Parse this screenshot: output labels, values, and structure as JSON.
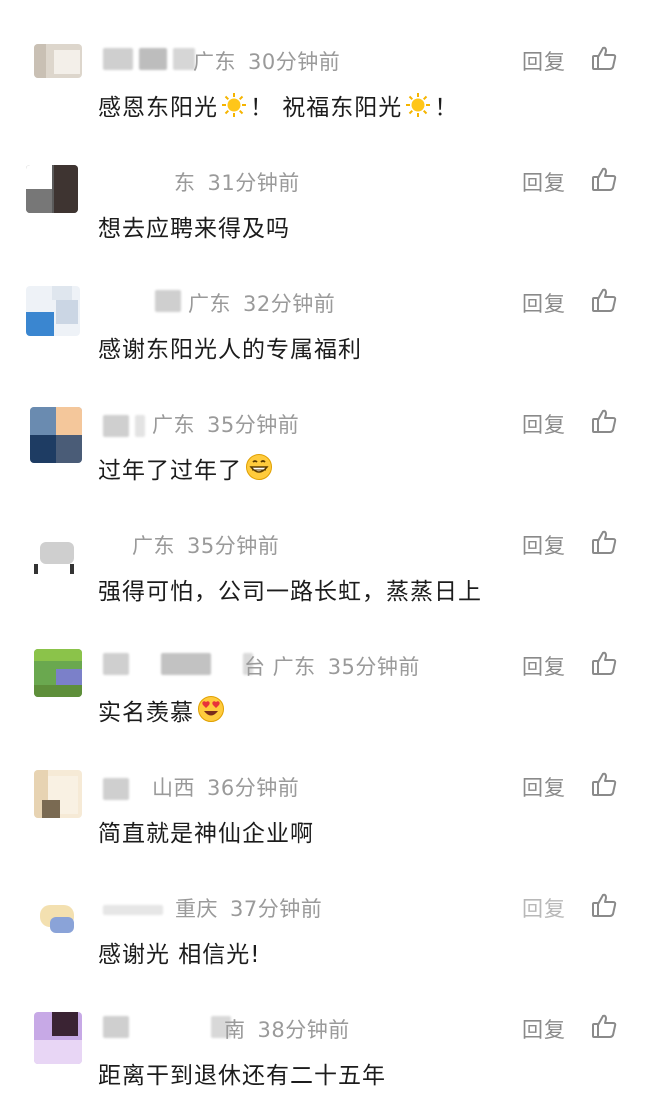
{
  "comments": [
    {
      "location": "广东",
      "time": "30分钟前",
      "text": "感恩东阳光",
      "text2": "！ 祝福东阳光",
      "text3": "！",
      "emoji": "sun",
      "reply": "回复"
    },
    {
      "location": "东",
      "time": "31分钟前",
      "text": "想去应聘来得及吗",
      "reply": "回复"
    },
    {
      "location": "广东",
      "time": "32分钟前",
      "text": "感谢东阳光人的专属福利",
      "reply": "回复"
    },
    {
      "location": "广东",
      "time": "35分钟前",
      "text": "过年了过年了",
      "emoji": "grin",
      "reply": "回复"
    },
    {
      "location": "广东",
      "time": "35分钟前",
      "text": "强得可怕，公司一路长虹，蒸蒸日上",
      "reply": "回复"
    },
    {
      "location": "台 广东",
      "time": "35分钟前",
      "text": "实名羡慕",
      "emoji": "heart-eyes",
      "reply": "回复"
    },
    {
      "location": "山西",
      "time": "36分钟前",
      "text": "简直就是神仙企业啊",
      "reply": "回复"
    },
    {
      "location": "重庆",
      "time": "37分钟前",
      "text": "感谢光 相信光!",
      "reply": "回复"
    },
    {
      "location": "南",
      "time": "38分钟前",
      "text": "距离干到退休还有二十五年",
      "reply": "回复"
    }
  ],
  "colors": {
    "meta": "#9a9a9a",
    "text": "#1c1c1c",
    "reply": "#8a8a8a",
    "icon": "#8a8a8a"
  }
}
